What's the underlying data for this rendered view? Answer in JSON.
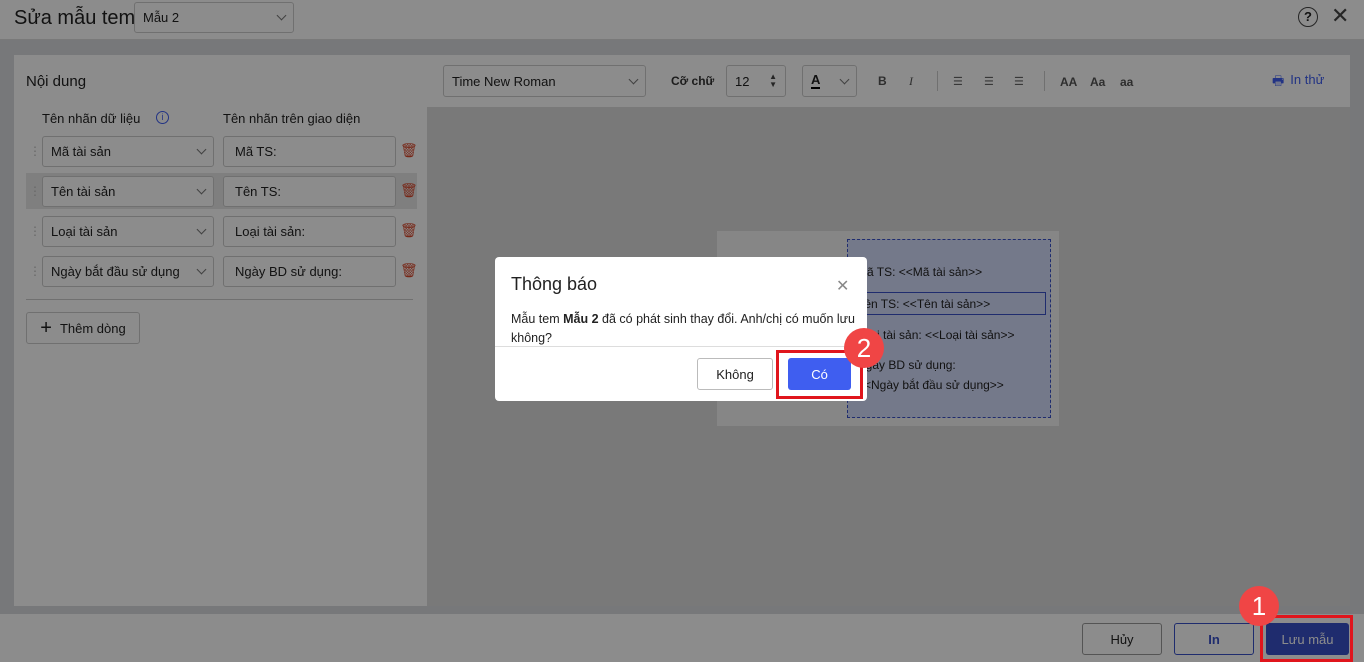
{
  "header": {
    "title": "Sửa mẫu tem:",
    "template_select": "Mẫu 2",
    "help_icon": "question-circle-icon",
    "close_icon": "close-icon"
  },
  "content": {
    "title": "Nội dung",
    "col_data_label": "Tên nhãn dữ liệu",
    "col_display_label": "Tên nhãn trên giao diện",
    "rows": [
      {
        "field": "Mã tài sản",
        "label": "Mã TS:"
      },
      {
        "field": "Tên tài sản",
        "label": "Tên TS:"
      },
      {
        "field": "Loại tài sản",
        "label": "Loại tài sản:"
      },
      {
        "field": "Ngày bắt đầu sử dụng",
        "label": "Ngày BD sử dụng:"
      }
    ],
    "add_row": "Thêm dòng"
  },
  "toolbar": {
    "font": "Time New Roman",
    "size_label": "Cỡ chữ",
    "size": "12",
    "color_btn": "A",
    "bold": "B",
    "italic": "I",
    "upper": "AA",
    "title_case": "Aa",
    "lower": "aa",
    "print_test": "In thử"
  },
  "preview": {
    "lines": [
      "Mã TS: <<Mã tài sản>>",
      "Tên TS: <<Tên tài sản>>",
      "Loại tài sản: <<Loại tài sản>>",
      "Ngày BD sử dụng:",
      "<<Ngày bắt đầu sử dụng>>"
    ]
  },
  "footer": {
    "cancel": "Hủy",
    "print": "In",
    "save": "Lưu mẫu"
  },
  "dialog": {
    "title": "Thông báo",
    "msg_prefix": "Mẫu tem ",
    "msg_bold": "Mẫu 2",
    "msg_suffix": " đã có phát sinh thay đổi. Anh/chị có muốn lưu không?",
    "no": "Không",
    "yes": "Có"
  },
  "annotations": {
    "step1": "1",
    "step2": "2"
  },
  "colors": {
    "primary": "#3f5ef0",
    "save": "#3a50c8",
    "annotation": "#e0151c"
  }
}
